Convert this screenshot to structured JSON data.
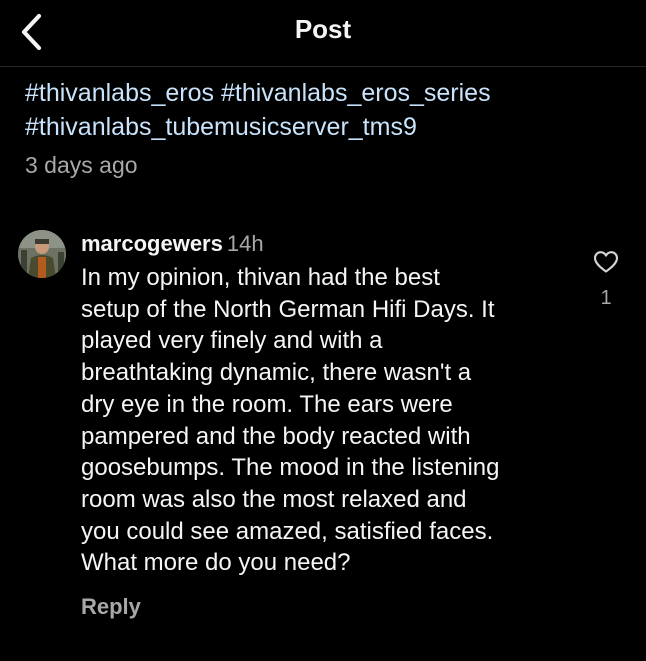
{
  "header": {
    "title": "Post"
  },
  "post": {
    "hashtags": [
      "#thivanlabs_eros",
      "#thivanlabs_eros_series",
      "#thivanlabs_tubemusicserver_tms9"
    ],
    "time": "3 days ago"
  },
  "comment": {
    "username": "marcogewers",
    "time": "14h",
    "lines": [
      "In my opinion, thivan had the best",
      "setup of the North German Hifi Days. It",
      "played very finely and with a",
      "breathtaking dynamic, there wasn't a",
      "dry eye in the room. The ears were",
      "pampered and the body reacted with",
      "goosebumps. The mood in the listening",
      "room was also the most relaxed and",
      "you could see amazed, satisfied faces.",
      "What more do you need?"
    ],
    "reply_label": "Reply",
    "like_count": "1"
  },
  "icons": {
    "back": "chevron-left-icon",
    "like": "heart-outline-icon"
  },
  "colors": {
    "background": "#000000",
    "text": "#f5f5f5",
    "hashtag": "#c8e3fb",
    "muted": "#a8a8a8"
  }
}
